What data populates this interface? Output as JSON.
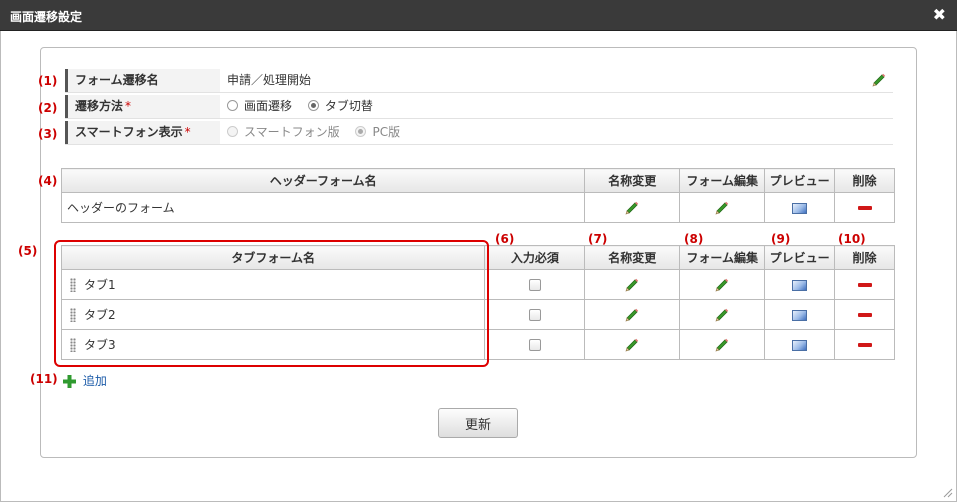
{
  "dialog": {
    "title": "画面遷移設定",
    "close_symbol": "✖"
  },
  "markers": [
    "(1)",
    "(2)",
    "(3)",
    "(4)",
    "(5)",
    "(6)",
    "(7)",
    "(8)",
    "(9)",
    "(10)",
    "(11)"
  ],
  "form": {
    "name_label": "フォーム遷移名",
    "name_value": "申請／処理開始",
    "transition_label": "遷移方法",
    "transition_required": "*",
    "transition_options": [
      "画面遷移",
      "タブ切替"
    ],
    "transition_selected": "タブ切替",
    "smartphone_label": "スマートフォン表示",
    "smartphone_required": "*",
    "smartphone_options": [
      "スマートフォン版",
      "PC版"
    ],
    "smartphone_selected": "PC版"
  },
  "header_table": {
    "columns": [
      "ヘッダーフォーム名",
      "名称変更",
      "フォーム編集",
      "プレビュー",
      "削除"
    ],
    "rows": [
      {
        "name": "ヘッダーのフォーム"
      }
    ]
  },
  "tab_table": {
    "columns": [
      "タブフォーム名",
      "入力必須",
      "名称変更",
      "フォーム編集",
      "プレビュー",
      "削除"
    ],
    "rows": [
      {
        "name": "タブ1",
        "required": false
      },
      {
        "name": "タブ2",
        "required": false
      },
      {
        "name": "タブ3",
        "required": false
      }
    ]
  },
  "add_label": "追加",
  "update_label": "更新",
  "colors": {
    "marker": "#cc0000",
    "highlight_box": "#dd0000",
    "pencil": "#3a9a2a",
    "delete": "#d01818",
    "link": "#1a5aa8"
  },
  "icons": {
    "edit": "pencil-icon",
    "preview": "preview-icon",
    "delete": "minus-icon",
    "add": "plus-icon",
    "drag": "drag-handle-icon",
    "close": "close-icon"
  }
}
